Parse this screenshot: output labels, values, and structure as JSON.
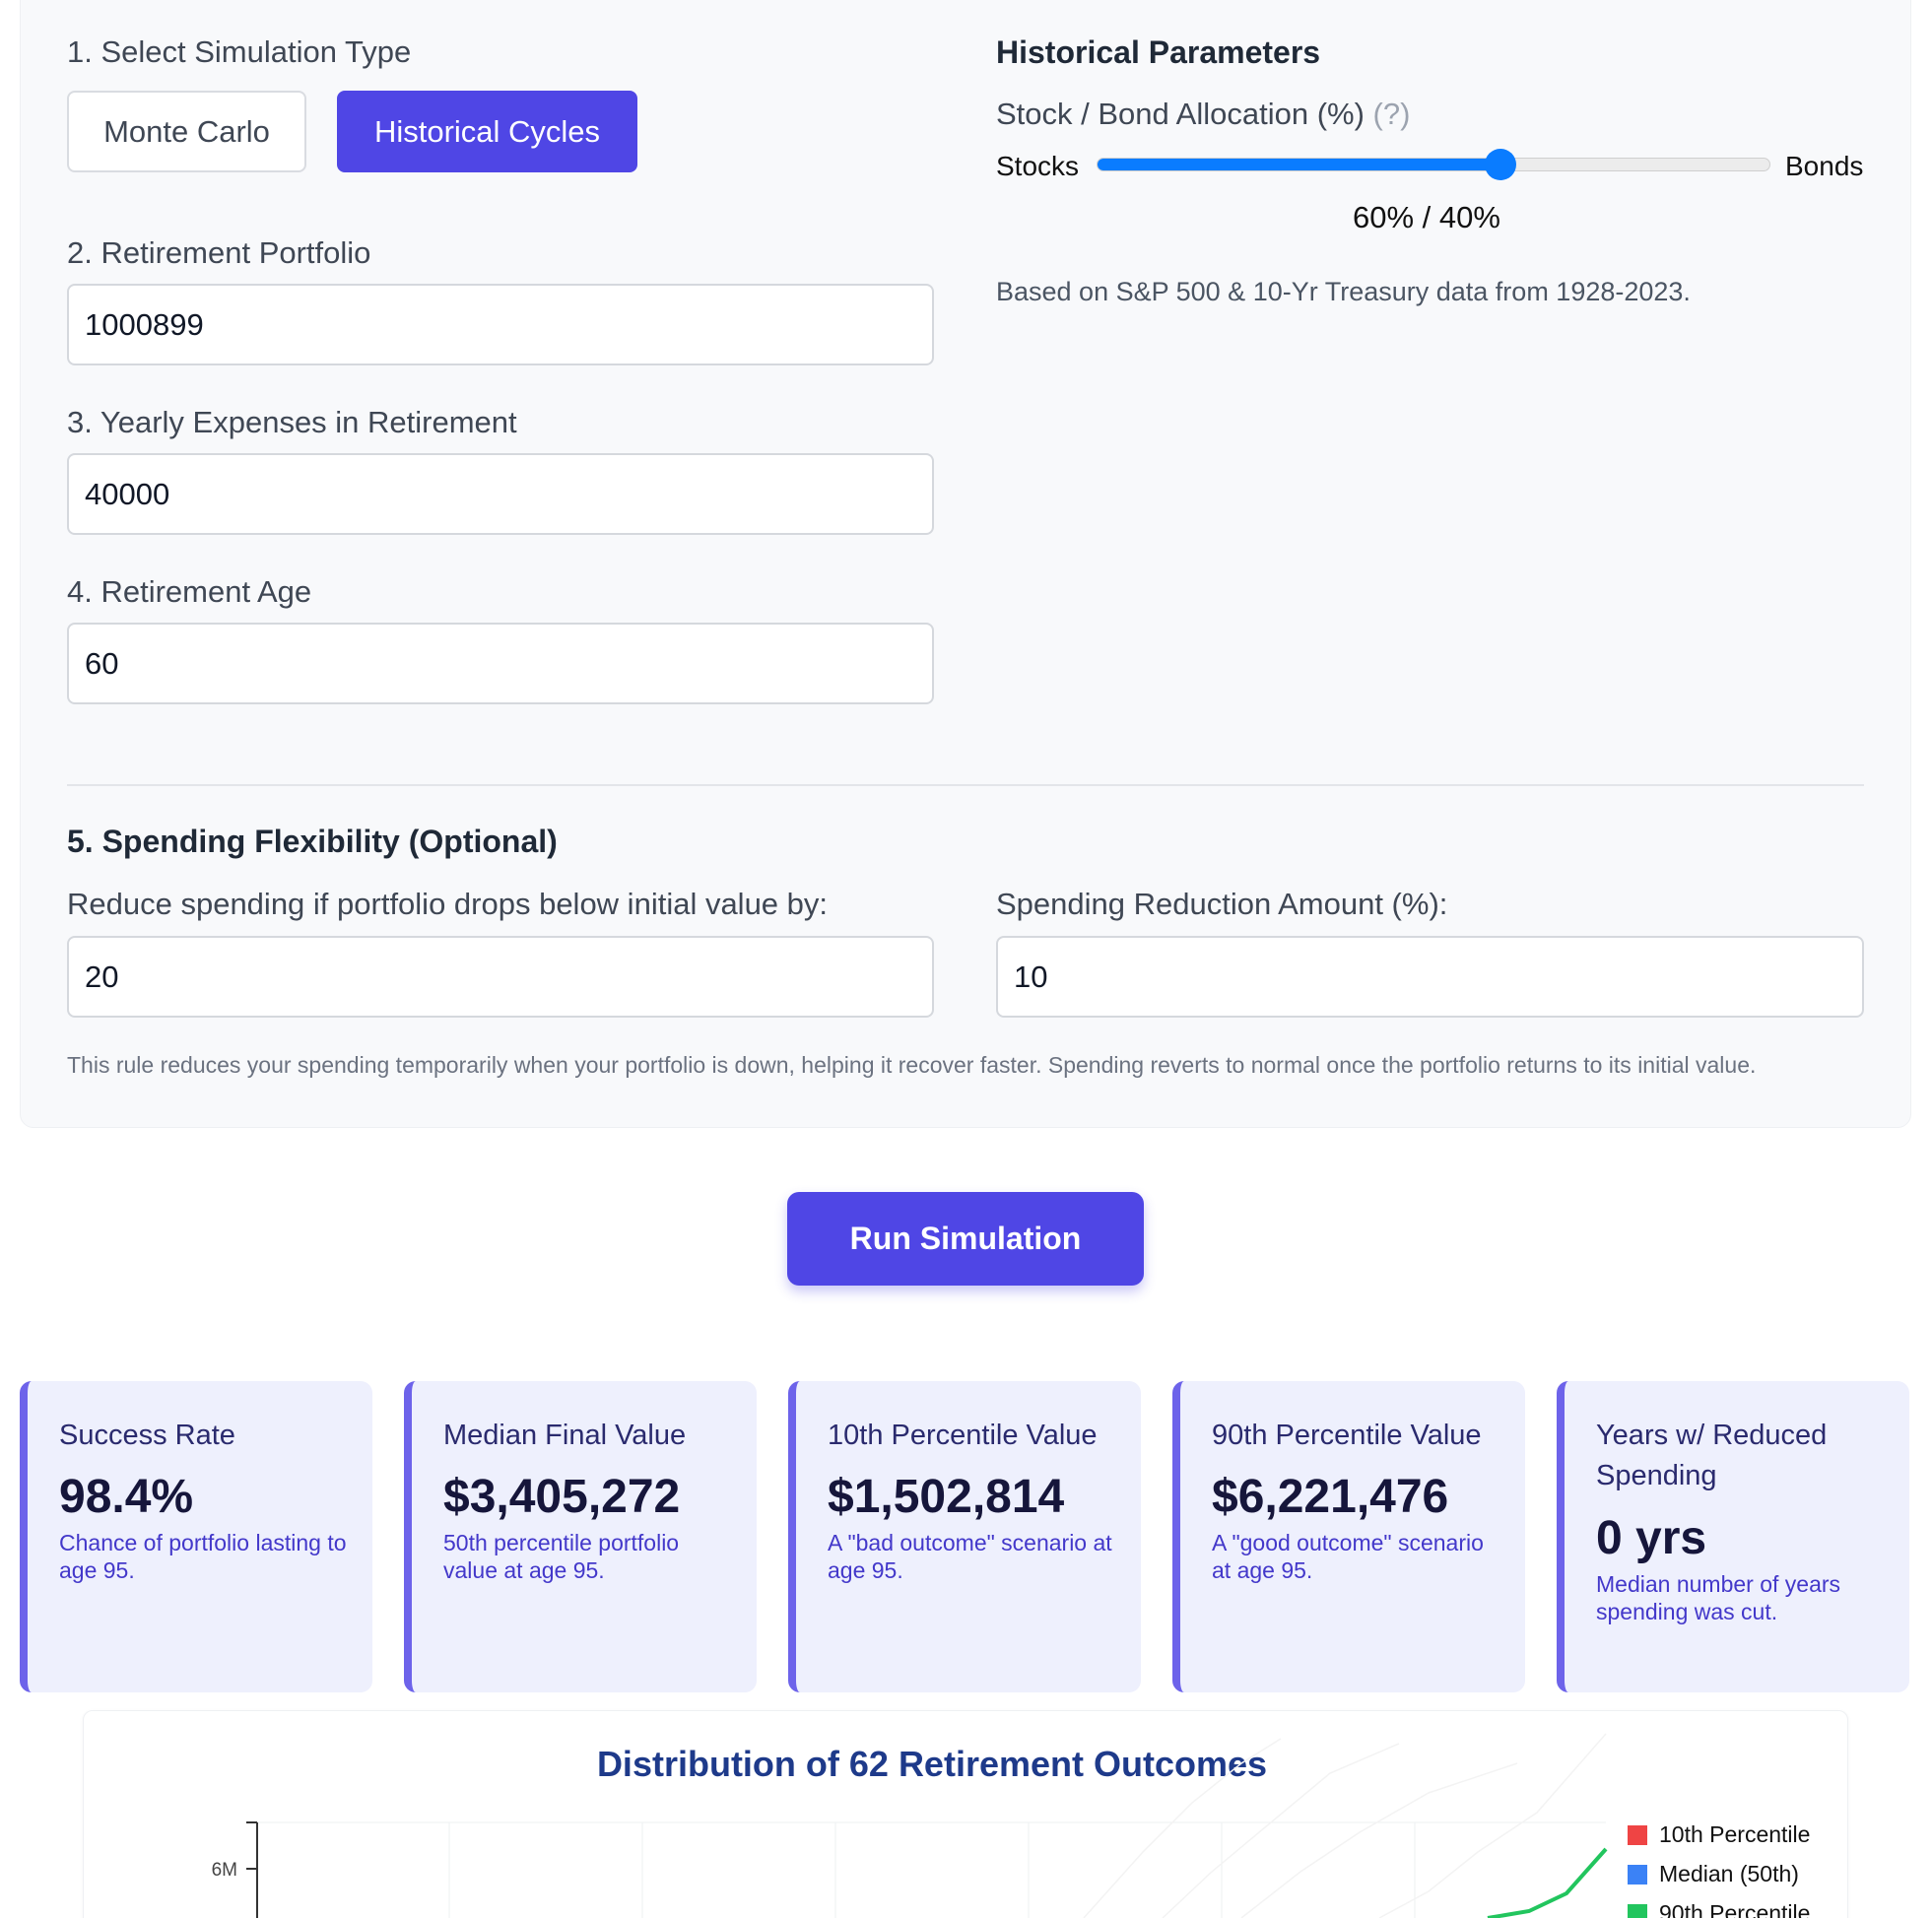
{
  "section1": {
    "label": "1. Select Simulation Type",
    "options": [
      {
        "label": "Monte Carlo",
        "selected": false
      },
      {
        "label": "Historical Cycles",
        "selected": true
      }
    ]
  },
  "section2": {
    "label": "2. Retirement Portfolio",
    "value": "1000899"
  },
  "section3": {
    "label": "3. Yearly Expenses in Retirement",
    "value": "40000"
  },
  "section4": {
    "label": "4. Retirement Age",
    "value": "60"
  },
  "historical": {
    "heading": "Historical Parameters",
    "allocation_label": "Stock / Bond Allocation (%)",
    "help": "(?)",
    "left_label": "Stocks",
    "right_label": "Bonds",
    "stock_fraction": 0.6,
    "readout": "60% / 40%",
    "note": "Based on S&P 500 & 10-Yr Treasury data from 1928-2023."
  },
  "section5": {
    "heading": "5. Spending Flexibility (Optional)",
    "threshold_label": "Reduce spending if portfolio drops below initial value by:",
    "threshold_value": "20",
    "reduction_label": "Spending Reduction Amount (%):",
    "reduction_value": "10",
    "help_text": "This rule reduces your spending temporarily when your portfolio is down, helping it recover faster. Spending reverts to normal once the portfolio returns to its initial value."
  },
  "run_button": "Run Simulation",
  "cards": [
    {
      "title": "Success Rate",
      "value": "98.4%",
      "desc": "Chance of portfolio lasting to age 95."
    },
    {
      "title": "Median Final Value",
      "value": "$3,405,272",
      "desc": "50th percentile portfolio value at age 95."
    },
    {
      "title": "10th Percentile Value",
      "value": "$1,502,814",
      "desc": "A \"bad outcome\" scenario at age 95."
    },
    {
      "title": "90th Percentile Value",
      "value": "$6,221,476",
      "desc": "A \"good outcome\" scenario at age 95."
    },
    {
      "title": "Years w/ Reduced Spending",
      "value": "0 yrs",
      "desc": "Median number of years spending was cut."
    }
  ],
  "chart_data": {
    "type": "line",
    "title": "Distribution of 62 Retirement Outcomes",
    "y_tick_labels": [
      "6M"
    ],
    "legend": [
      {
        "name": "10th Percentile",
        "color": "#ef4444"
      },
      {
        "name": "Median (50th)",
        "color": "#3b82f6"
      },
      {
        "name": "90th Percentile",
        "color": "#22c55e"
      }
    ]
  },
  "colors": {
    "accent": "#4f46e5",
    "slider": "#0a7cff"
  }
}
